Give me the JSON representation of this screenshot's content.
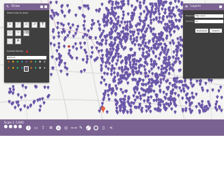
{
  "draw_panel": {
    "title": "Draw",
    "section_tools": "Select tool to draw",
    "section_symbol": "Symbol library",
    "symbol_select": "Default",
    "tools": [
      "point",
      "line",
      "polygon",
      "arrow",
      "text",
      "circle",
      "freehand",
      "erase",
      "select",
      "label"
    ],
    "symbols": [
      "pin",
      "pin",
      "pin",
      "pin",
      "pin",
      "pin",
      "pin",
      "pin",
      "pin",
      "pin",
      "pin",
      "pin",
      "pin",
      "pin",
      "pin",
      "pin",
      "pin",
      "pin"
    ]
  },
  "layers_panel": {
    "title": "Layers",
    "fields": [
      {
        "label": "Basemap",
        "value": "Map style"
      },
      {
        "label": "Overlay",
        "value": "All"
      }
    ],
    "buttons": [
      "Download",
      "Export"
    ]
  },
  "bottom_bar": {
    "coords": "Scale 1: 5,000",
    "icons": [
      "info",
      "print",
      "export",
      "layers",
      "home",
      "location",
      "measure",
      "draw",
      "full-extent",
      "share"
    ]
  },
  "map": {
    "marker_color": "#6b57a8",
    "accent": "#7a6392",
    "pin_color": "#e8603c",
    "labels": [
      "",
      ""
    ]
  }
}
